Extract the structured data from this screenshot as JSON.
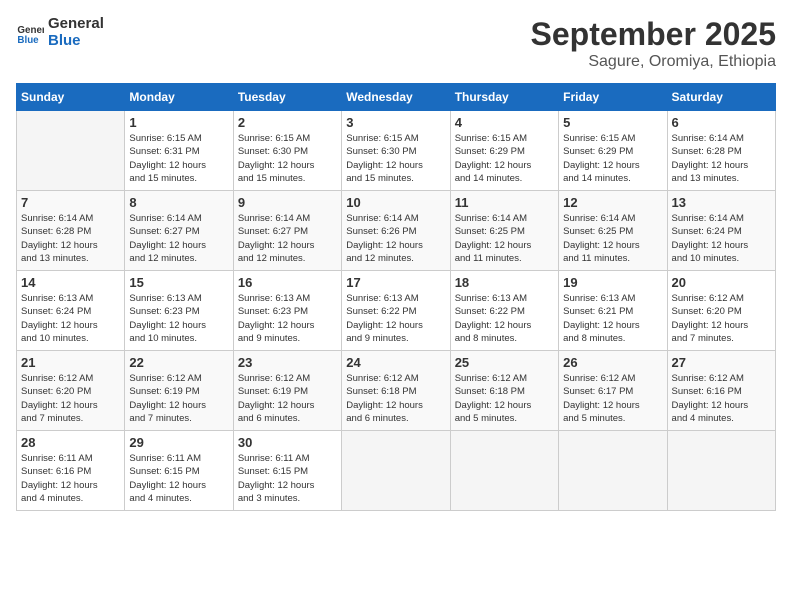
{
  "logo": {
    "line1": "General",
    "line2": "Blue"
  },
  "title": "September 2025",
  "subtitle": "Sagure, Oromiya, Ethiopia",
  "days_of_week": [
    "Sunday",
    "Monday",
    "Tuesday",
    "Wednesday",
    "Thursday",
    "Friday",
    "Saturday"
  ],
  "weeks": [
    [
      {
        "day": "",
        "info": ""
      },
      {
        "day": "1",
        "info": "Sunrise: 6:15 AM\nSunset: 6:31 PM\nDaylight: 12 hours\nand 15 minutes."
      },
      {
        "day": "2",
        "info": "Sunrise: 6:15 AM\nSunset: 6:30 PM\nDaylight: 12 hours\nand 15 minutes."
      },
      {
        "day": "3",
        "info": "Sunrise: 6:15 AM\nSunset: 6:30 PM\nDaylight: 12 hours\nand 15 minutes."
      },
      {
        "day": "4",
        "info": "Sunrise: 6:15 AM\nSunset: 6:29 PM\nDaylight: 12 hours\nand 14 minutes."
      },
      {
        "day": "5",
        "info": "Sunrise: 6:15 AM\nSunset: 6:29 PM\nDaylight: 12 hours\nand 14 minutes."
      },
      {
        "day": "6",
        "info": "Sunrise: 6:14 AM\nSunset: 6:28 PM\nDaylight: 12 hours\nand 13 minutes."
      }
    ],
    [
      {
        "day": "7",
        "info": "Sunrise: 6:14 AM\nSunset: 6:28 PM\nDaylight: 12 hours\nand 13 minutes."
      },
      {
        "day": "8",
        "info": "Sunrise: 6:14 AM\nSunset: 6:27 PM\nDaylight: 12 hours\nand 12 minutes."
      },
      {
        "day": "9",
        "info": "Sunrise: 6:14 AM\nSunset: 6:27 PM\nDaylight: 12 hours\nand 12 minutes."
      },
      {
        "day": "10",
        "info": "Sunrise: 6:14 AM\nSunset: 6:26 PM\nDaylight: 12 hours\nand 12 minutes."
      },
      {
        "day": "11",
        "info": "Sunrise: 6:14 AM\nSunset: 6:25 PM\nDaylight: 12 hours\nand 11 minutes."
      },
      {
        "day": "12",
        "info": "Sunrise: 6:14 AM\nSunset: 6:25 PM\nDaylight: 12 hours\nand 11 minutes."
      },
      {
        "day": "13",
        "info": "Sunrise: 6:14 AM\nSunset: 6:24 PM\nDaylight: 12 hours\nand 10 minutes."
      }
    ],
    [
      {
        "day": "14",
        "info": "Sunrise: 6:13 AM\nSunset: 6:24 PM\nDaylight: 12 hours\nand 10 minutes."
      },
      {
        "day": "15",
        "info": "Sunrise: 6:13 AM\nSunset: 6:23 PM\nDaylight: 12 hours\nand 10 minutes."
      },
      {
        "day": "16",
        "info": "Sunrise: 6:13 AM\nSunset: 6:23 PM\nDaylight: 12 hours\nand 9 minutes."
      },
      {
        "day": "17",
        "info": "Sunrise: 6:13 AM\nSunset: 6:22 PM\nDaylight: 12 hours\nand 9 minutes."
      },
      {
        "day": "18",
        "info": "Sunrise: 6:13 AM\nSunset: 6:22 PM\nDaylight: 12 hours\nand 8 minutes."
      },
      {
        "day": "19",
        "info": "Sunrise: 6:13 AM\nSunset: 6:21 PM\nDaylight: 12 hours\nand 8 minutes."
      },
      {
        "day": "20",
        "info": "Sunrise: 6:12 AM\nSunset: 6:20 PM\nDaylight: 12 hours\nand 7 minutes."
      }
    ],
    [
      {
        "day": "21",
        "info": "Sunrise: 6:12 AM\nSunset: 6:20 PM\nDaylight: 12 hours\nand 7 minutes."
      },
      {
        "day": "22",
        "info": "Sunrise: 6:12 AM\nSunset: 6:19 PM\nDaylight: 12 hours\nand 7 minutes."
      },
      {
        "day": "23",
        "info": "Sunrise: 6:12 AM\nSunset: 6:19 PM\nDaylight: 12 hours\nand 6 minutes."
      },
      {
        "day": "24",
        "info": "Sunrise: 6:12 AM\nSunset: 6:18 PM\nDaylight: 12 hours\nand 6 minutes."
      },
      {
        "day": "25",
        "info": "Sunrise: 6:12 AM\nSunset: 6:18 PM\nDaylight: 12 hours\nand 5 minutes."
      },
      {
        "day": "26",
        "info": "Sunrise: 6:12 AM\nSunset: 6:17 PM\nDaylight: 12 hours\nand 5 minutes."
      },
      {
        "day": "27",
        "info": "Sunrise: 6:12 AM\nSunset: 6:16 PM\nDaylight: 12 hours\nand 4 minutes."
      }
    ],
    [
      {
        "day": "28",
        "info": "Sunrise: 6:11 AM\nSunset: 6:16 PM\nDaylight: 12 hours\nand 4 minutes."
      },
      {
        "day": "29",
        "info": "Sunrise: 6:11 AM\nSunset: 6:15 PM\nDaylight: 12 hours\nand 4 minutes."
      },
      {
        "day": "30",
        "info": "Sunrise: 6:11 AM\nSunset: 6:15 PM\nDaylight: 12 hours\nand 3 minutes."
      },
      {
        "day": "",
        "info": ""
      },
      {
        "day": "",
        "info": ""
      },
      {
        "day": "",
        "info": ""
      },
      {
        "day": "",
        "info": ""
      }
    ]
  ]
}
